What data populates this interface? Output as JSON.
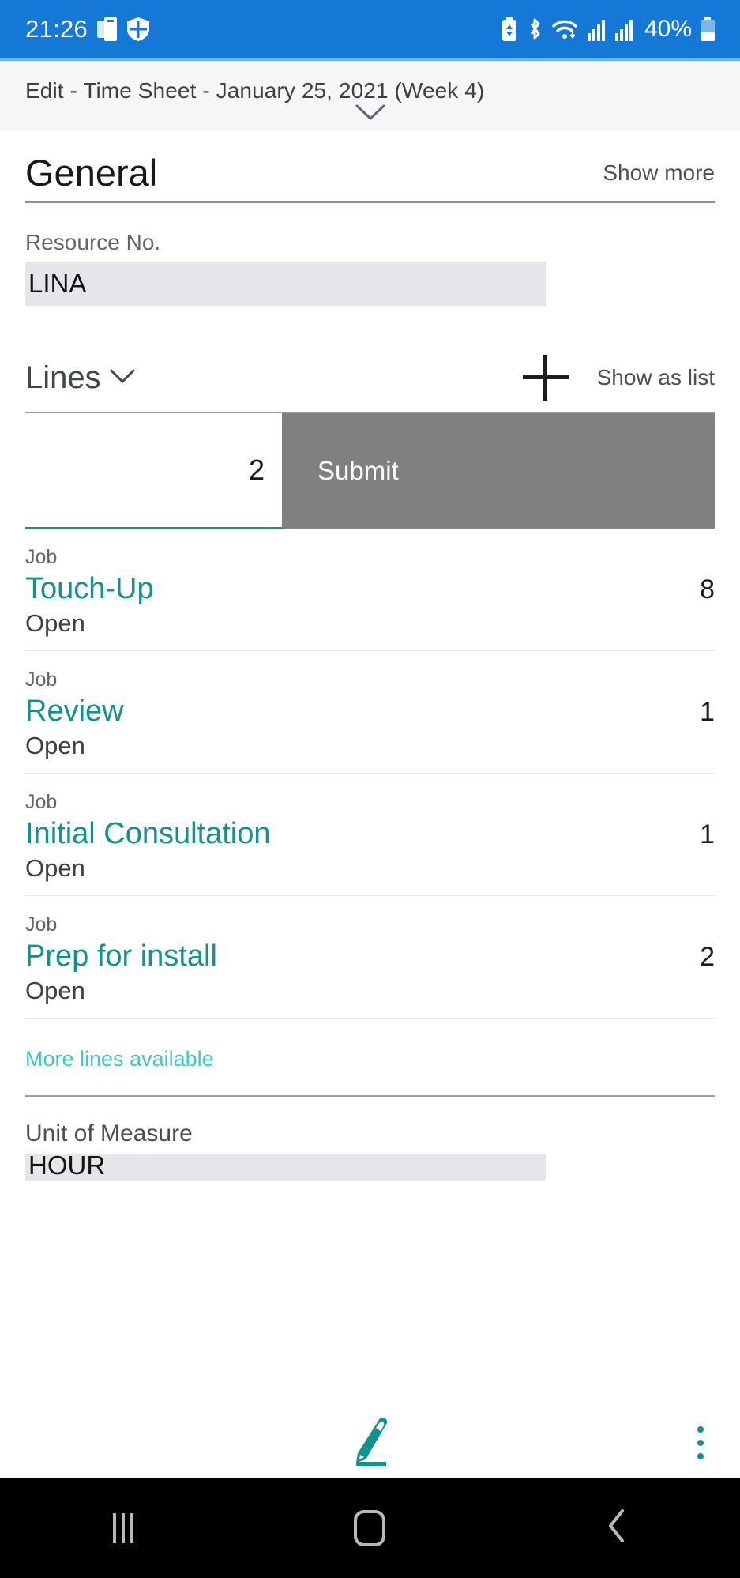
{
  "status_bar": {
    "clock": "21:26",
    "battery_percent": "40%",
    "icons": [
      "dual-sim-icon",
      "security-shield-icon",
      "battery-saver-icon",
      "bluetooth-icon",
      "wifi-icon",
      "signal-bars-icon",
      "signal-bars-2-icon",
      "battery-icon"
    ],
    "background_color": "#1578d6"
  },
  "title_bar": {
    "title": "Edit - Time Sheet - January 25, 2021 (Week 4)",
    "expand_icon": "chevron-down-icon"
  },
  "general": {
    "heading": "General",
    "show_more": "Show more",
    "resource_no": {
      "label": "Resource No.",
      "value": "LINA"
    }
  },
  "lines": {
    "heading": "Lines",
    "heading_icon": "chevron-down-icon",
    "add_icon": "plus-icon",
    "show_as_list": "Show as list",
    "swipe_row": {
      "quantity": "2",
      "action_label": "Submit",
      "action_color": "#808080"
    },
    "items": [
      {
        "kind": "Job",
        "name": "Touch-Up",
        "status": "Open",
        "quantity": "8"
      },
      {
        "kind": "Job",
        "name": "Review",
        "status": "Open",
        "quantity": "1"
      },
      {
        "kind": "Job",
        "name": "Initial Consultation",
        "status": "Open",
        "quantity": "1"
      },
      {
        "kind": "Job",
        "name": "Prep for install",
        "status": "Open",
        "quantity": "2"
      }
    ],
    "more_lines": "More lines available"
  },
  "unit_of_measure": {
    "label": "Unit of Measure",
    "value": "HOUR"
  },
  "action_bar": {
    "edit_icon": "pencil-icon",
    "overflow_icon": "kebab-menu-icon"
  },
  "nav_bar": {
    "recents_icon": "recents-icon",
    "home_icon": "home-icon",
    "back_icon": "back-icon"
  },
  "colors": {
    "accent_teal": "#13918c",
    "link_teal": "#3fc8c8",
    "status_blue": "#1578d6"
  }
}
